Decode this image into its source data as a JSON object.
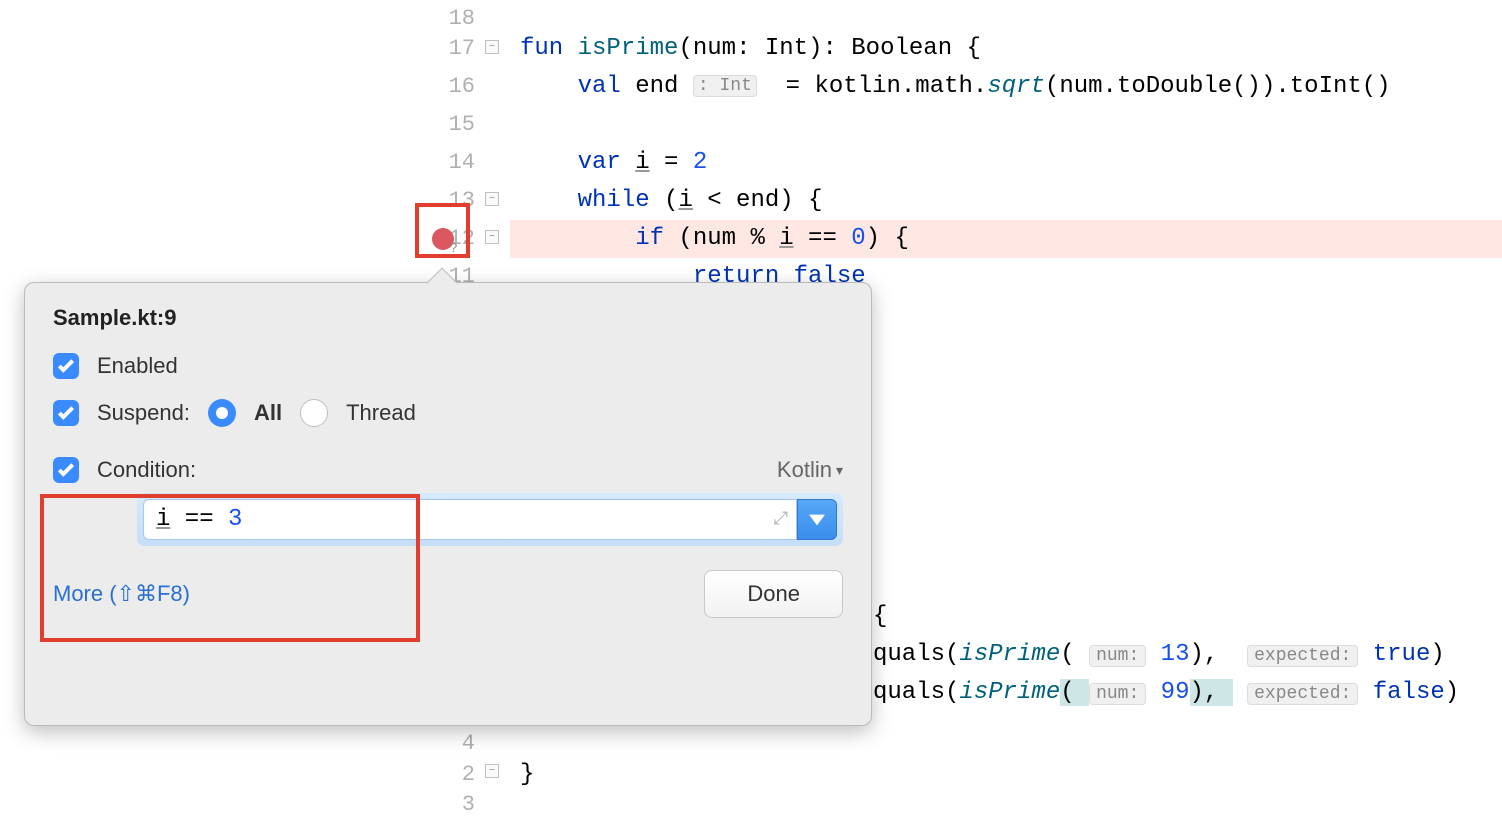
{
  "gutter": {
    "lines": [
      "18",
      "17",
      "16",
      "15",
      "14",
      "13",
      "12",
      "11",
      "",
      "",
      "",
      "4",
      "",
      "",
      "",
      "",
      "",
      "",
      "2",
      "3"
    ]
  },
  "code": {
    "l1_fun": "fun",
    "l1_isPrime": "isPrime",
    "l1_rest": "(num: Int): Boolean {",
    "l2_val": "val",
    "l2_end": "end",
    "l2_hint": ": Int",
    "l2_rest1": "  = kotlin.math.",
    "l2_sqrt": "sqrt",
    "l2_rest2": "(num.toDouble()).toInt()",
    "l4_var": "var",
    "l4_i": "i",
    "l4_eq": " = ",
    "l4_num": "2",
    "l5_while": "while",
    "l5_rest": " (",
    "l5_i": "i",
    "l5_rest2": " < end) {",
    "l6_if": "if",
    "l6_rest1": " (num % ",
    "l6_i": "i",
    "l6_rest2": " == ",
    "l6_num": "0",
    "l6_rest3": ") {",
    "l7_return": "return",
    "l7_false": " false",
    "l12_open": "{",
    "l13_quals": "quals(",
    "l13_isPrime": "isPrime",
    "l13_p1": "( ",
    "l13_numhint": "num:",
    "l13_num13": " 13",
    "l13_p2": "), ",
    "l13_exphint": "expected:",
    "l13_true": " true",
    "l13_p3": ")",
    "l14_quals": "quals(",
    "l14_isPrime": "isPrime",
    "l14_p1": "( ",
    "l14_numhint": "num:",
    "l14_num99": " 99",
    "l14_p2": "), ",
    "l14_exphint": "expected:",
    "l14_false": " false",
    "l14_p3": ")",
    "l16_brace": "}"
  },
  "popup": {
    "title": "Sample.kt:9",
    "enabled_label": "Enabled",
    "suspend_label": "Suspend:",
    "suspend_all": "All",
    "suspend_thread": "Thread",
    "condition_label": "Condition:",
    "language": "Kotlin",
    "cond_i": "i",
    "cond_eq": " == ",
    "cond_val": "3",
    "more": "More (⇧⌘F8)",
    "done": "Done"
  }
}
